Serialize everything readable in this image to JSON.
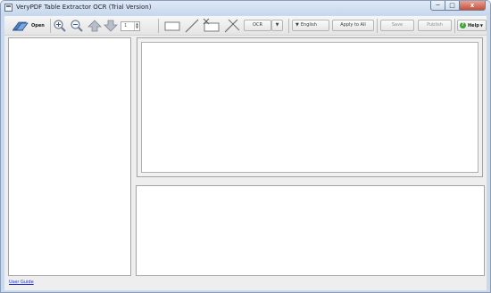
{
  "window": {
    "title": "VeryPDF Table Extractor OCR (Trial Version)",
    "caption_buttons": {
      "minimize": "─",
      "maximize": "□",
      "close": "x"
    }
  },
  "toolbar": {
    "open_label": "Open",
    "page_number": "1",
    "spin_up": "▲",
    "spin_down": "▼",
    "ocr_label": "OCR",
    "ocr_dropdown_glyph": "▼",
    "language_arrow": "▼",
    "language_label": "English",
    "apply_label": "Apply to All",
    "save_label": "Save",
    "publish_label": "Publish",
    "help_dot": "?",
    "help_label": "Help",
    "help_arrow": "▼"
  },
  "footer": {
    "user_guide_label": "User Guide"
  },
  "colors": {
    "frame": "#c9d9ee",
    "close_button": "#c84f3a",
    "link": "#1a2bd8",
    "help_accent": "#3ea63a"
  },
  "icons": {
    "open": "open-folder-icon",
    "zoom_in": "zoom-in-icon",
    "zoom_out": "zoom-out-icon",
    "page_up": "page-up-icon",
    "page_down": "page-down-icon",
    "rectangle": "rectangle-tool-icon",
    "line": "line-tool-icon",
    "delete_rectangle": "delete-rectangle-icon",
    "delete_line": "delete-line-icon"
  }
}
